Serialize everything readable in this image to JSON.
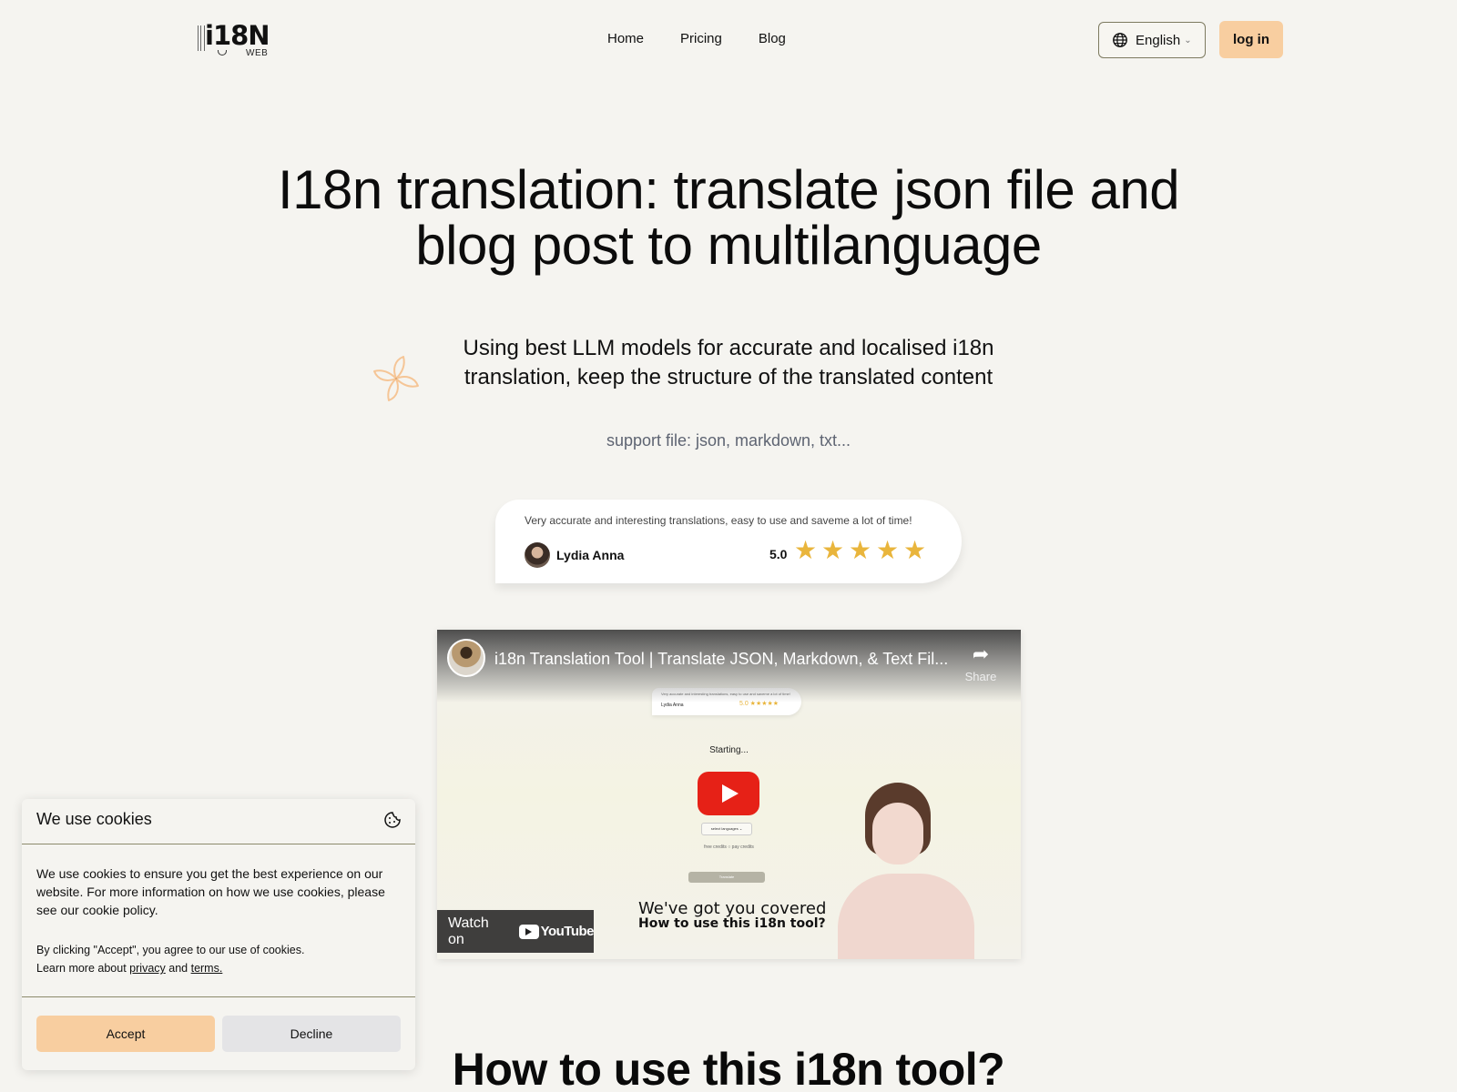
{
  "header": {
    "logo": {
      "word": "i18N",
      "sub": "WEB"
    },
    "nav": [
      {
        "label": "Home"
      },
      {
        "label": "Pricing"
      },
      {
        "label": "Blog"
      }
    ],
    "language": {
      "icon": "globe-icon",
      "label": "English"
    },
    "login_label": "log in"
  },
  "hero": {
    "title_line1": "I18n translation: translate json file and",
    "title_line2": "blog post to multilanguage",
    "subtitle": "Using best LLM models for accurate and localised i18n translation, keep the structure of the translated content",
    "support": "support file: json, markdown, txt..."
  },
  "review": {
    "quote": "Very accurate and interesting translations, easy to use and saveme a lot of time!",
    "name": "Lydia Anna",
    "score": "5.0",
    "stars": 5,
    "star_color": "#e9b53c"
  },
  "video": {
    "title": "i18n Translation Tool | Translate JSON, Markdown, & Text Fil...",
    "share_label": "Share",
    "starting_label": "Starting...",
    "mini_quote": "Very accurate and interesting translations, easy to use and saveme a lot of time!",
    "mini_name": "Lydia Anna",
    "mini_score": "5.0 ★★★★★",
    "select_languages": "select languages ⌄",
    "credits": "free credits   ○   pay credits",
    "translate_btn": "Translate",
    "watch_on": "Watch on",
    "youtube": "YouTube",
    "caption1": "We've got you covered",
    "caption2": "How to use this i18n tool?",
    "play_color": "#e62117"
  },
  "cookie": {
    "title": "We use cookies",
    "body": "We use cookies to ensure you get the best experience on our website. For more information on how we use cookies, please see our cookie policy.",
    "consent": "By clicking \"Accept\", you agree to our use of cookies.",
    "learn_prefix": "Learn more about",
    "privacy": "privacy",
    "and": "and",
    "terms": "terms.",
    "accept": "Accept",
    "decline": "Decline",
    "accent": "#f8cea0"
  },
  "section": {
    "howto_title": "How to use this i18n tool?"
  }
}
